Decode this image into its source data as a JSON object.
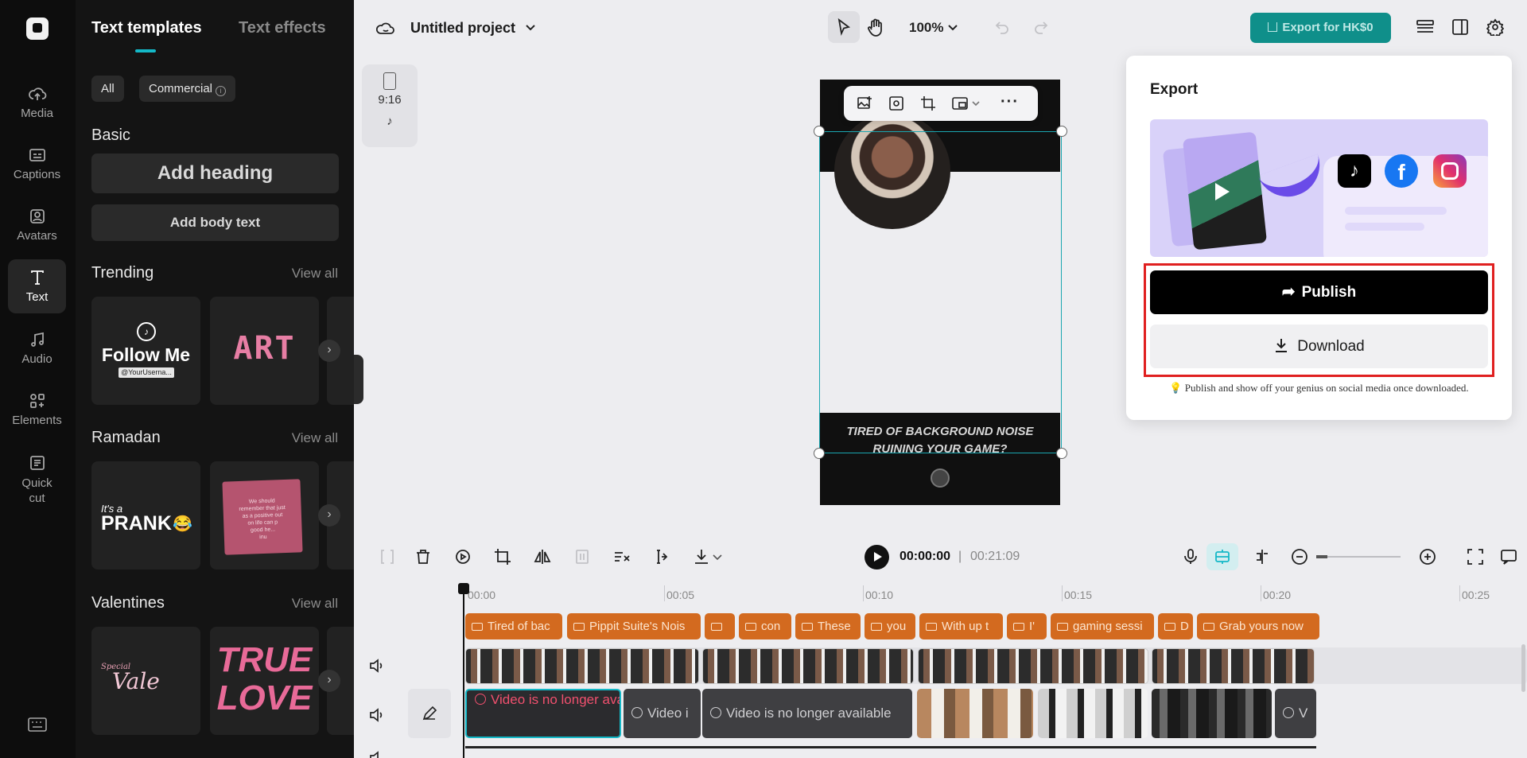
{
  "nav": {
    "items": [
      {
        "label": "Media",
        "icon": "cloud-upload-icon"
      },
      {
        "label": "Captions",
        "icon": "captions-icon"
      },
      {
        "label": "Avatars",
        "icon": "avatar-icon"
      },
      {
        "label": "Text",
        "icon": "text-icon"
      },
      {
        "label": "Audio",
        "icon": "music-note-icon"
      },
      {
        "label": "Elements",
        "icon": "elements-icon"
      },
      {
        "label": "Quick cut",
        "icon": "quick-cut-icon"
      }
    ],
    "active_label": "Text"
  },
  "panel": {
    "tabs": [
      "Text templates",
      "Text effects"
    ],
    "filters": {
      "all": "All",
      "commercial": "Commercial"
    },
    "basic": {
      "title": "Basic",
      "add_heading": "Add heading",
      "add_body": "Add body text"
    },
    "trending": {
      "title": "Trending",
      "view_all": "View all",
      "thumb1_line1": "Follow Me",
      "thumb1_line2": "@YourUserna...",
      "thumb2": "ART"
    },
    "ramadan": {
      "title": "Ramadan",
      "view_all": "View all",
      "thumb1_line1": "It's a",
      "thumb1_line2": "PRANK",
      "thumb1_emoji": "😂",
      "thumb2_line1": "We should",
      "thumb2_line2": "remember that just",
      "thumb2_line3": "as a positive out",
      "thumb2_line4": "on life can p",
      "thumb2_line5": "good he...",
      "thumb2_line6": "inu"
    },
    "valentines": {
      "title": "Valentines",
      "view_all": "View all",
      "thumb1_line1": "Special",
      "thumb1_line2": "Vale",
      "thumb2_line1": "TRUE",
      "thumb2_line2": "LOVE"
    }
  },
  "topbar": {
    "project_title": "Untitled project",
    "zoom": "100%",
    "export_label": "Export for HK$0"
  },
  "canvas": {
    "ratio": "9:16",
    "caption_line1": "TIRED OF BACKGROUND NOISE",
    "caption_line2": "RUINING YOUR GAME?"
  },
  "export": {
    "title": "Export",
    "publish": "Publish",
    "download": "Download",
    "note": "Publish and show off your genius on social media once downloaded."
  },
  "timeline": {
    "current_time": "00:00:00",
    "separator": "|",
    "total_time": "00:21:09",
    "ruler": [
      "00:00",
      "00:05",
      "00:10",
      "00:15",
      "00:20",
      "00:25"
    ],
    "captions": [
      "Tired of bac",
      "Pippit Suite's Nois",
      "",
      "con",
      "These",
      "you",
      "With up t",
      "I'",
      "gaming sessi",
      "D",
      "Grab yours now"
    ],
    "media_warning": "Video is no longer available",
    "media_short1": "Video i",
    "media_short2": "V"
  },
  "colors": {
    "accent": "#14b8c7",
    "export_button": "#0f8f8a",
    "caption_clip": "#d36a1f",
    "highlight": "#e02020"
  }
}
